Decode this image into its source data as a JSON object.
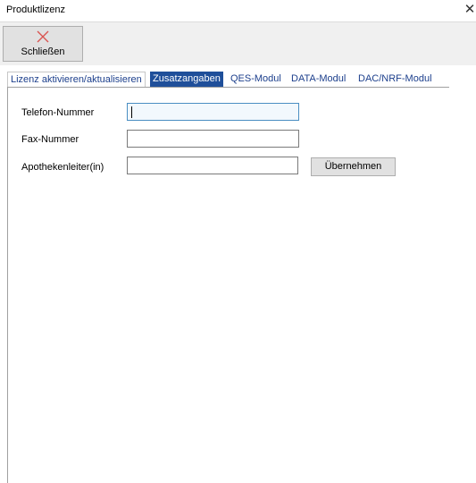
{
  "window": {
    "title": "Produktlizenz",
    "close_glyph": "✕"
  },
  "toolbar": {
    "close_button_label": "Schließen",
    "close_button_icon": "close-icon"
  },
  "tabs": [
    {
      "label": "Lizenz aktivieren/aktualisieren",
      "active": false
    },
    {
      "label": "Zusatzangaben",
      "active": true
    },
    {
      "label": "QES-Modul",
      "active": false
    },
    {
      "label": "DATA-Modul",
      "active": false
    },
    {
      "label": "DAC/NRF-Modul",
      "active": false
    }
  ],
  "form": {
    "phone": {
      "label": "Telefon-Nummer",
      "value": ""
    },
    "fax": {
      "label": "Fax-Nummer",
      "value": ""
    },
    "manager": {
      "label": "Apothekenleiter(in)",
      "value": ""
    },
    "apply_button_label": "Übernehmen"
  },
  "colors": {
    "active_tab_bg": "#1f4f9a",
    "tab_text": "#1c3f8c",
    "close_icon": "#d9534f"
  }
}
